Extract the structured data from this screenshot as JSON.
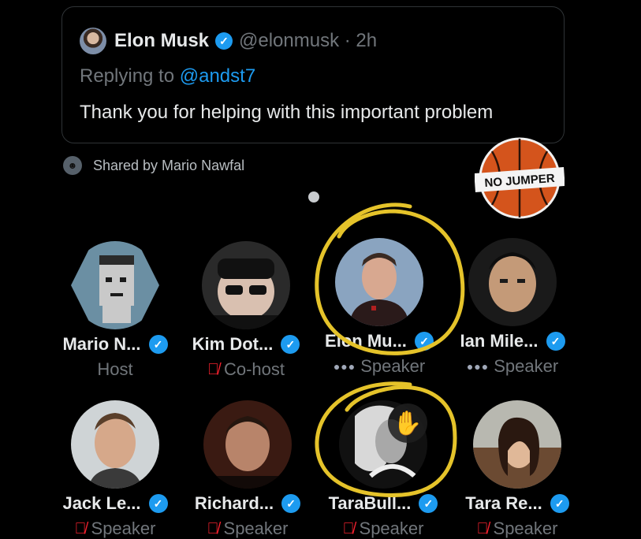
{
  "quoted_tweet": {
    "author_name": "Elon Musk",
    "handle_time": "@elonmusk · 2h",
    "replying_prefix": "Replying to",
    "replying_mention": "@andst7",
    "text": "Thank you for helping with this important problem"
  },
  "shared_by": "Shared by Mario Nawfal",
  "watermark": "NO JUMPER",
  "speakers": [
    {
      "name": "Mario N...",
      "role": "Host",
      "role_icon": "none",
      "verified": true
    },
    {
      "name": "Kim Dot...",
      "role": "Co-host",
      "role_icon": "mic-off-icon",
      "verified": true
    },
    {
      "name": "Elon Mu...",
      "role": "Speaker",
      "role_icon": "speaking-dots-icon",
      "verified": true
    },
    {
      "name": "Ian Mile...",
      "role": "Speaker",
      "role_icon": "speaking-dots-icon",
      "verified": true
    },
    {
      "name": "Jack Le...",
      "role": "Speaker",
      "role_icon": "mic-off-icon",
      "verified": true
    },
    {
      "name": "Richard...",
      "role": "Speaker",
      "role_icon": "mic-off-icon",
      "verified": true
    },
    {
      "name": "TaraBull...",
      "role": "Speaker",
      "role_icon": "mic-off-icon",
      "verified": true,
      "hand_raised": true
    },
    {
      "name": "Tara Re...",
      "role": "Speaker",
      "role_icon": "mic-off-icon",
      "verified": true
    }
  ],
  "colors": {
    "accent": "#1d9bf0",
    "highlight": "#e5c32a",
    "background": "#000000",
    "muted": "#71767b"
  }
}
